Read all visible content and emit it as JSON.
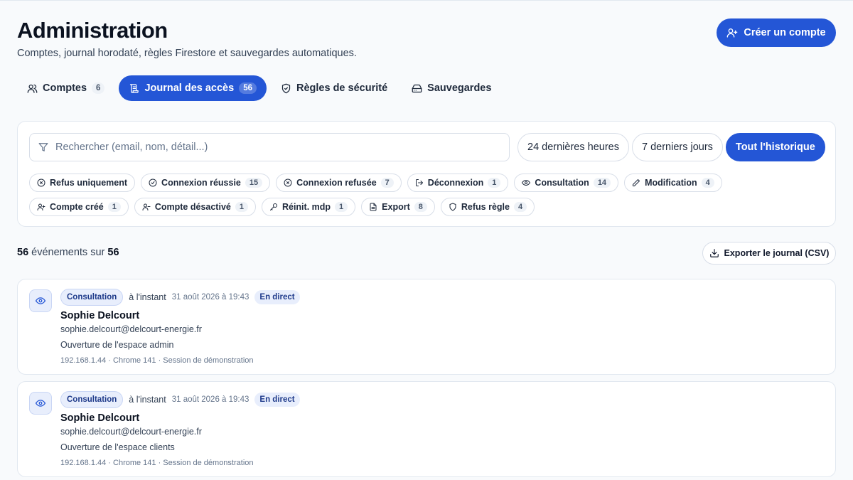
{
  "header": {
    "title": "Administration",
    "subtitle": "Comptes, journal horodaté, règles Firestore et sauvegardes automatiques.",
    "create_label": "Créer un compte"
  },
  "tabs": [
    {
      "label": "Comptes",
      "count": "6",
      "icon": "users-icon",
      "active": false
    },
    {
      "label": "Journal des accès",
      "count": "56",
      "icon": "scroll-icon",
      "active": true
    },
    {
      "label": "Règles de sécurité",
      "count": "",
      "icon": "shield-icon",
      "active": false
    },
    {
      "label": "Sauvegardes",
      "count": "",
      "icon": "drive-icon",
      "active": false
    }
  ],
  "filters": {
    "search_placeholder": "Rechercher (email, nom, détail...)",
    "ranges": [
      {
        "label": "24 dernières heures",
        "active": false
      },
      {
        "label": "7 derniers jours",
        "active": false
      },
      {
        "label": "Tout l'historique",
        "active": true
      }
    ],
    "chips": [
      {
        "label": "Refus uniquement",
        "count": "",
        "icon": "x-circle-icon"
      },
      {
        "label": "Connexion réussie",
        "count": "15",
        "icon": "check-circle-icon"
      },
      {
        "label": "Connexion refusée",
        "count": "7",
        "icon": "x-circle-icon"
      },
      {
        "label": "Déconnexion",
        "count": "1",
        "icon": "logout-icon"
      },
      {
        "label": "Consultation",
        "count": "14",
        "icon": "eye-icon"
      },
      {
        "label": "Modification",
        "count": "4",
        "icon": "pencil-icon"
      },
      {
        "label": "Compte créé",
        "count": "1",
        "icon": "user-plus-icon"
      },
      {
        "label": "Compte désactivé",
        "count": "1",
        "icon": "user-minus-icon"
      },
      {
        "label": "Réinit. mdp",
        "count": "1",
        "icon": "key-icon"
      },
      {
        "label": "Export",
        "count": "8",
        "icon": "file-icon"
      },
      {
        "label": "Refus règle",
        "count": "4",
        "icon": "shield-icon"
      }
    ]
  },
  "summary": {
    "shown": "56",
    "middle": " événements sur ",
    "total": "56",
    "export_label": "Exporter le journal (CSV)"
  },
  "events": [
    {
      "type": "Consultation",
      "when": "à l'instant",
      "timestamp": "31 août 2026 à 19:43",
      "live": "En direct",
      "name": "Sophie Delcourt",
      "email": "sophie.delcourt@delcourt-energie.fr",
      "detail": "Ouverture de l'espace admin",
      "tech": "192.168.1.44 · Chrome 141 · Session de démonstration"
    },
    {
      "type": "Consultation",
      "when": "à l'instant",
      "timestamp": "31 août 2026 à 19:43",
      "live": "En direct",
      "name": "Sophie Delcourt",
      "email": "sophie.delcourt@delcourt-energie.fr",
      "detail": "Ouverture de l'espace clients",
      "tech": "192.168.1.44 · Chrome 141 · Session de démonstration"
    }
  ],
  "colors": {
    "accent": "#2456d6",
    "background": "#f8fafc",
    "badge_bg": "#e8eefc",
    "badge_text": "#1e3a8a"
  }
}
